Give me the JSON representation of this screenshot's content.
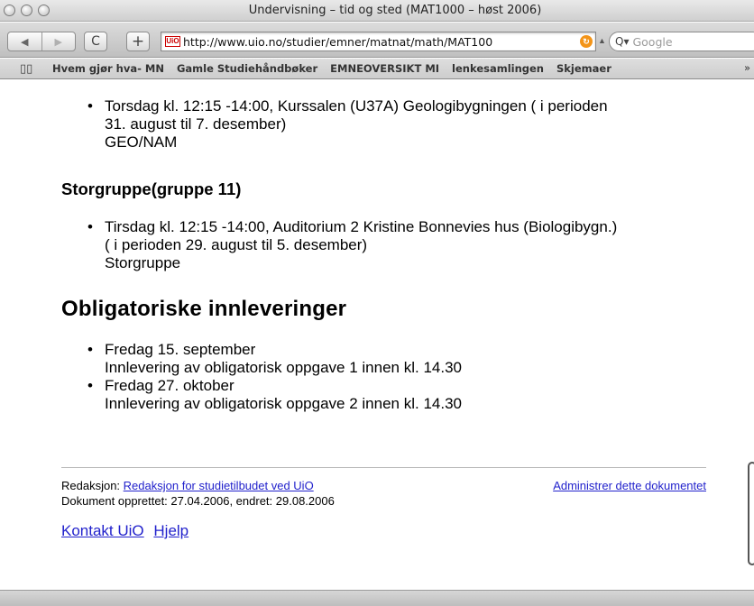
{
  "window": {
    "title": "Undervisning – tid og sted (MAT1000 – høst 2006)"
  },
  "toolbar": {
    "back_label": "◀",
    "forward_label": "▶",
    "reload_label": "C",
    "add_label": "+",
    "favicon_text": "UiO",
    "url": "http://www.uio.no/studier/emner/matnat/math/MAT100",
    "search_placeholder": "Google"
  },
  "bookmarks": {
    "items": [
      "Hvem gjør hva- MN",
      "Gamle Studiehåndbøker",
      "EMNEOVERSIKT MI",
      "lenkesamlingen",
      "Skjemaer"
    ],
    "more": "»"
  },
  "content": {
    "item_geo": {
      "line1": "Torsdag kl. 12:15 -14:00, Kurssalen (U37A) Geologibygningen ( i perioden",
      "line2": "31. august til 7. desember)",
      "line3": "GEO/NAM"
    },
    "storgruppe_heading": "Storgruppe(gruppe 11)",
    "item_storgruppe": {
      "line1": "Tirsdag kl. 12:15 -14:00, Auditorium 2 Kristine Bonnevies hus (Biologibygn.)",
      "line2": "( i perioden 29. august til 5. desember)",
      "line3": "Storgruppe"
    },
    "oblig_heading": "Obligatoriske innleveringer",
    "oblig_items": [
      {
        "date": "Fredag 15. september",
        "text": "Innlevering av obligatorisk oppgave 1 innen kl. 14.30"
      },
      {
        "date": "Fredag 27. oktober",
        "text": "Innlevering av obligatorisk oppgave 2 innen kl. 14.30"
      }
    ]
  },
  "footer": {
    "redaksjon_label": "Redaksjon:",
    "redaksjon_link": "Redaksjon for studietilbudet ved UiO",
    "document_info": "Dokument opprettet: 27.04.2006, endret: 29.08.2006",
    "admin_link": "Administrer dette dokumentet",
    "contact_link": "Kontakt UiO",
    "help_link": "Hjelp"
  }
}
